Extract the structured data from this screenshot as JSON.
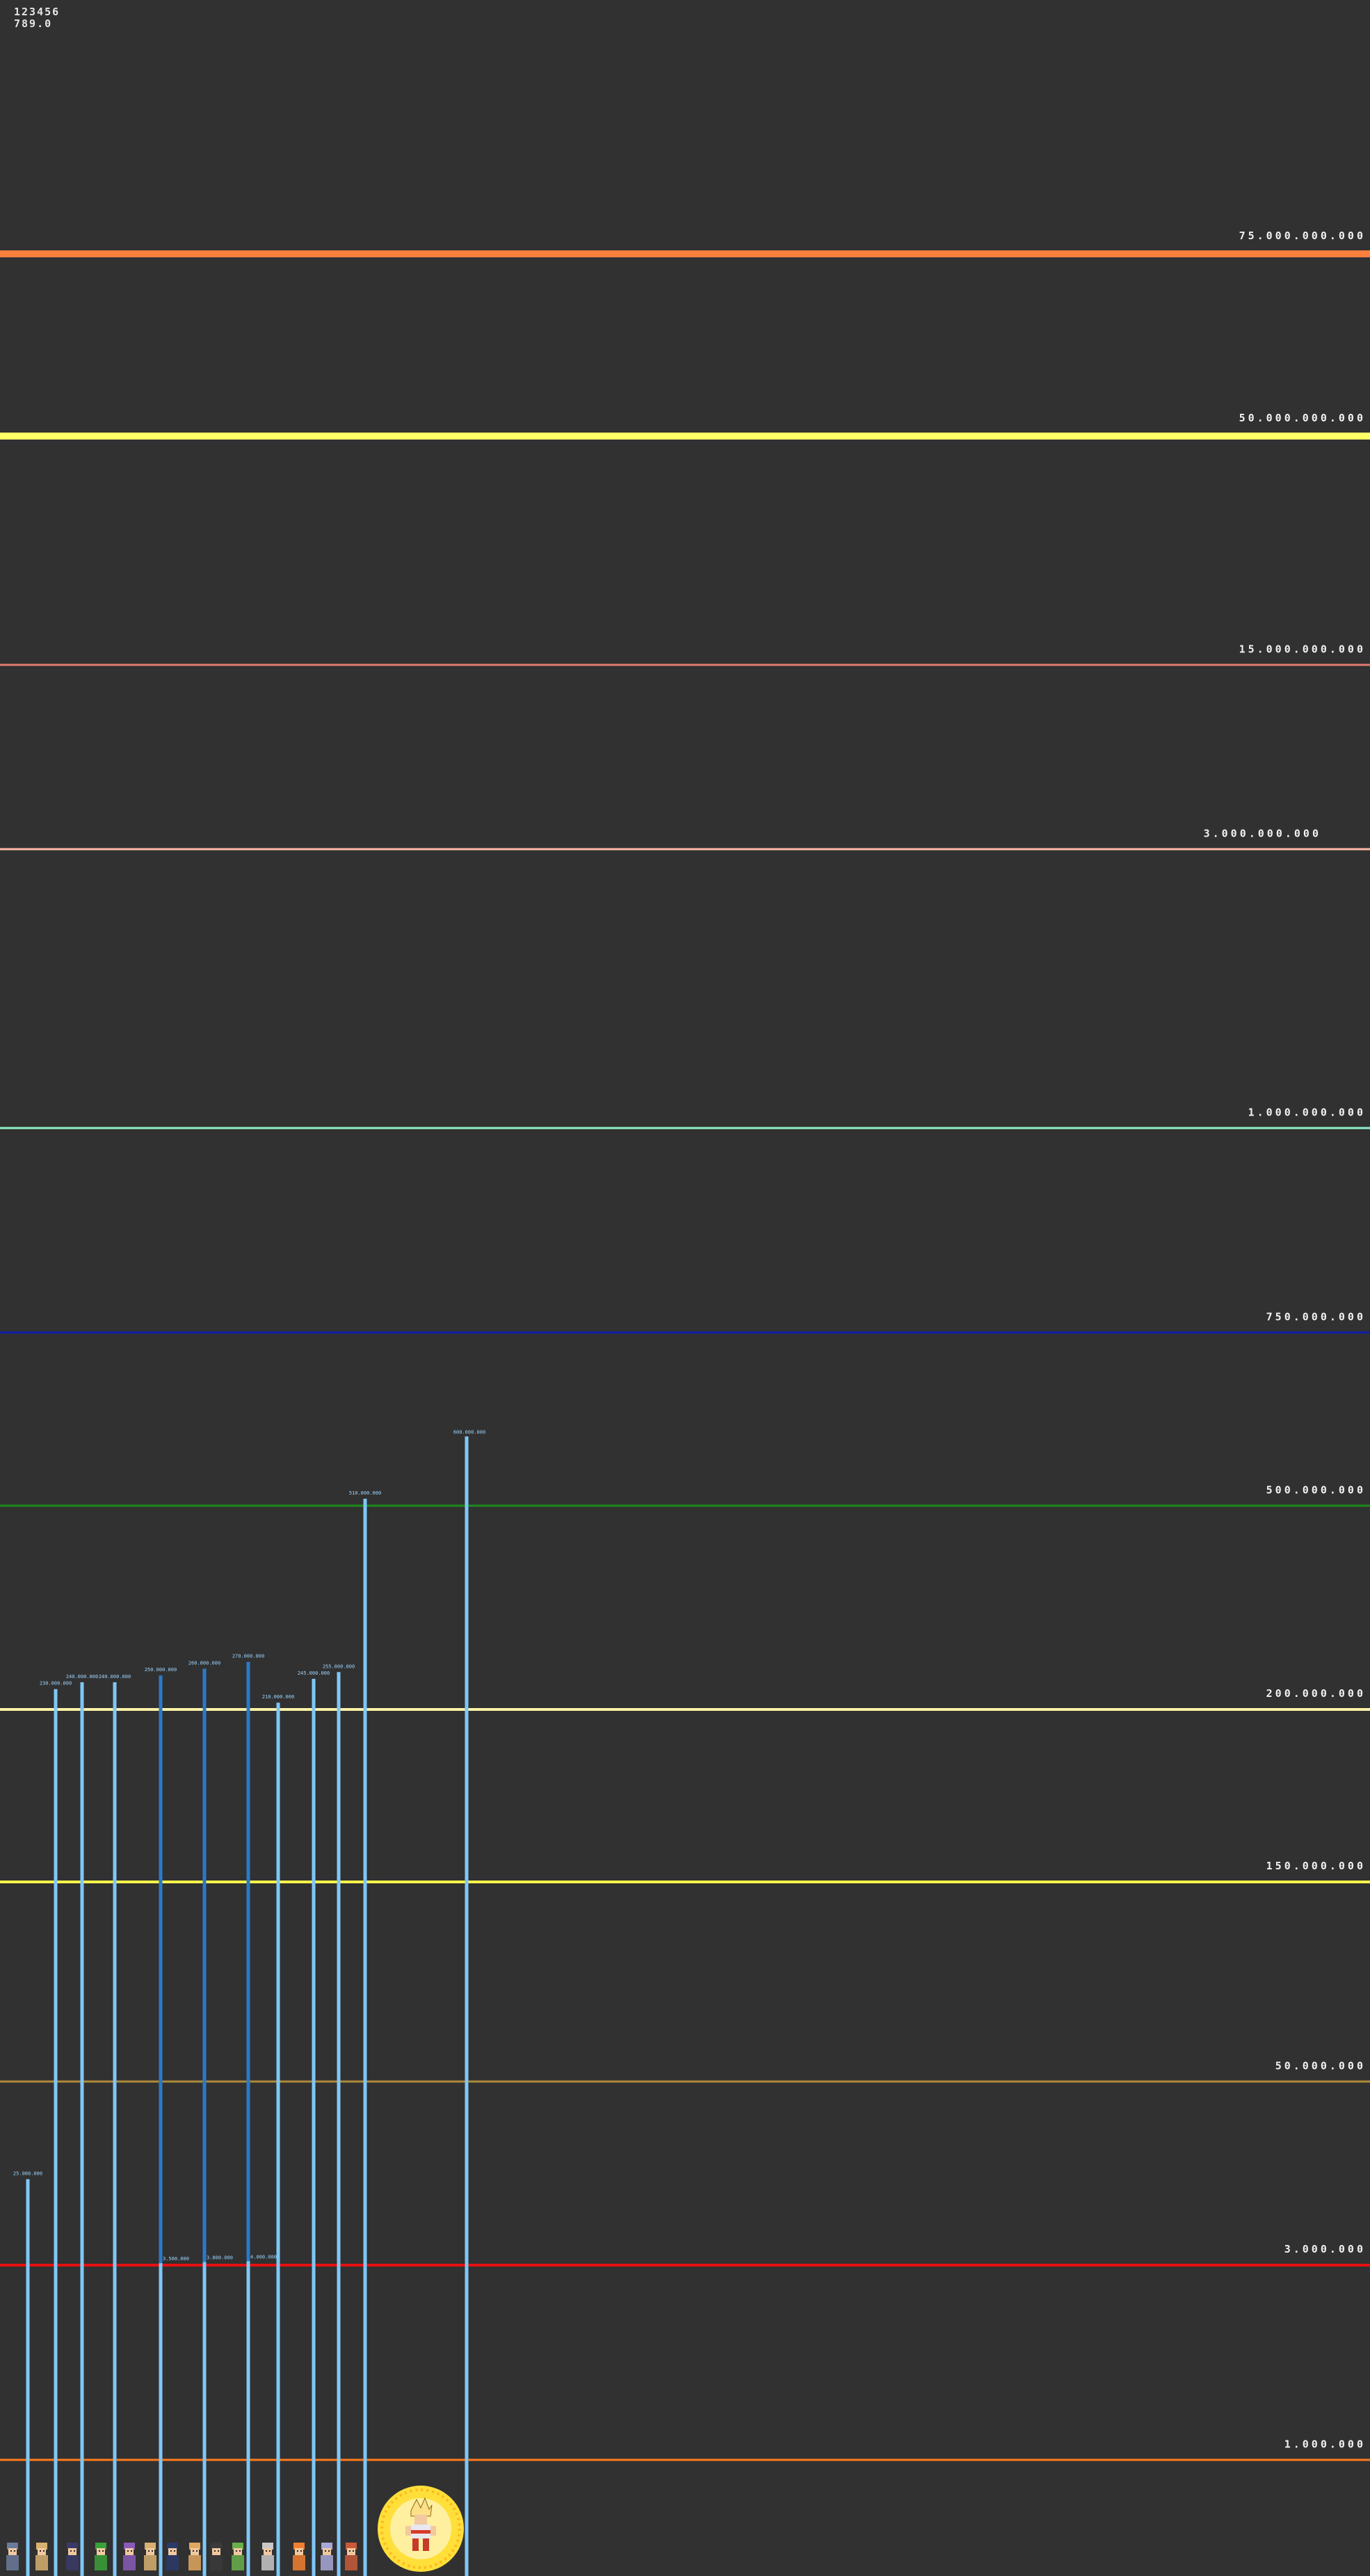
{
  "header": {
    "counter": "123456",
    "value": "789.0"
  },
  "chart_data": {
    "type": "bar",
    "title": "",
    "xlabel": "",
    "ylabel": "",
    "grid": false,
    "note": "Non-linear power-level scale; thresholds are drawn as colored horizontal lines with labels at the right edge.",
    "thresholds": [
      {
        "label": "75.000.000.000",
        "value": 75000000000,
        "color": "#ff7f3f"
      },
      {
        "label": "50.000.000.000",
        "value": 50000000000,
        "color": "#ffff66"
      },
      {
        "label": "15.000.000.000",
        "value": 15000000000,
        "color": "#e07a6f"
      },
      {
        "label": "3.000.000.000",
        "value": 3000000000,
        "color": "#ffb8a8"
      },
      {
        "label": "1.000.000.000",
        "value": 1000000000,
        "color": "#8ff2c8"
      },
      {
        "label": "750.000.000",
        "value": 750000000,
        "color": "#0e1ea8"
      },
      {
        "label": "500.000.000",
        "value": 500000000,
        "color": "#1a8a1a"
      },
      {
        "label": "200.000.000",
        "value": 200000000,
        "color": "#fff2a8"
      },
      {
        "label": "150.000.000",
        "value": 150000000,
        "color": "#ffff4a"
      },
      {
        "label": "50.000.000",
        "value": 50000000,
        "color": "#b08a3a"
      },
      {
        "label": "3.000.000",
        "value": 3000000,
        "color": "#e81010"
      },
      {
        "label": "1.000.000",
        "value": 1000000,
        "color": "#ff7a1a"
      }
    ],
    "bars": [
      {
        "character": "fighter-1",
        "value": 25000000,
        "label": "25.000.000",
        "color": "#7fc7f7"
      },
      {
        "character": "fighter-2",
        "value": 230000000,
        "label": "230.000.000",
        "color": "#7fc7f7"
      },
      {
        "character": "fighter-3",
        "value": 240000000,
        "label": "240.000.000",
        "color": "#7fc7f7"
      },
      {
        "character": "fighter-4",
        "value": 240000000,
        "label": "240.000.000",
        "color": "#7fc7f7"
      },
      {
        "character": "fighter-5",
        "value": 250000000,
        "label": "250.000.000",
        "color": "#2a7ac8",
        "base_value": 3500000,
        "base_label": "3.500.000",
        "base_color": "#7fc7f7"
      },
      {
        "character": "fighter-6",
        "value": 260000000,
        "label": "260.000.000",
        "color": "#2a7ac8",
        "base_value": 3800000,
        "base_label": "3.800.000",
        "base_color": "#7fc7f7"
      },
      {
        "character": "fighter-7",
        "value": 270000000,
        "label": "270.000.000",
        "color": "#2a7ac8",
        "base_value": 4000000,
        "base_label": "4.000.000",
        "base_color": "#7fc7f7"
      },
      {
        "character": "fighter-8",
        "value": 210000000,
        "label": "210.000.000",
        "color": "#7fc7f7"
      },
      {
        "character": "fighter-9",
        "value": 245000000,
        "label": "245.000.000",
        "color": "#7fc7f7"
      },
      {
        "character": "fighter-10",
        "value": 255000000,
        "label": "255.000.000",
        "color": "#7fc7f7"
      },
      {
        "character": "fighter-11",
        "value": 510000000,
        "label": "510.000.000",
        "color": "#7fc7f7"
      },
      {
        "character": "highlighted-fighter",
        "value": 600000000,
        "label": "600.000.000",
        "color": "#7fc7f7"
      }
    ]
  }
}
